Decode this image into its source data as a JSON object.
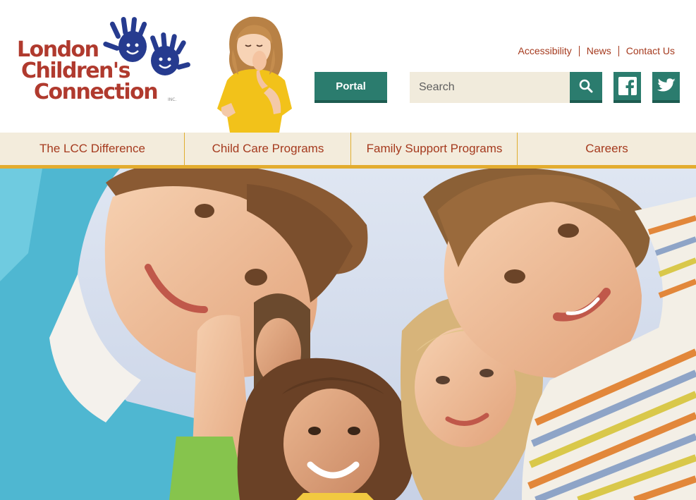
{
  "logo": {
    "line1": "London",
    "line2": "Children's",
    "line3": "Connection",
    "inc": "INC."
  },
  "top_links": [
    "Accessibility",
    "News",
    "Contact Us"
  ],
  "portal_label": "Portal",
  "search": {
    "placeholder": "Search"
  },
  "nav": [
    "The LCC Difference",
    "Child Care Programs",
    "Family Support Programs",
    "Careers"
  ],
  "colors": {
    "brand_red": "#b03a2e",
    "teal": "#2b7c6e",
    "nav_bg": "#f3ecdc",
    "gold": "#e3ad2f",
    "hand_blue": "#263b8f"
  },
  "icons": [
    "handprints-icon",
    "search-icon",
    "facebook-icon",
    "twitter-icon"
  ]
}
